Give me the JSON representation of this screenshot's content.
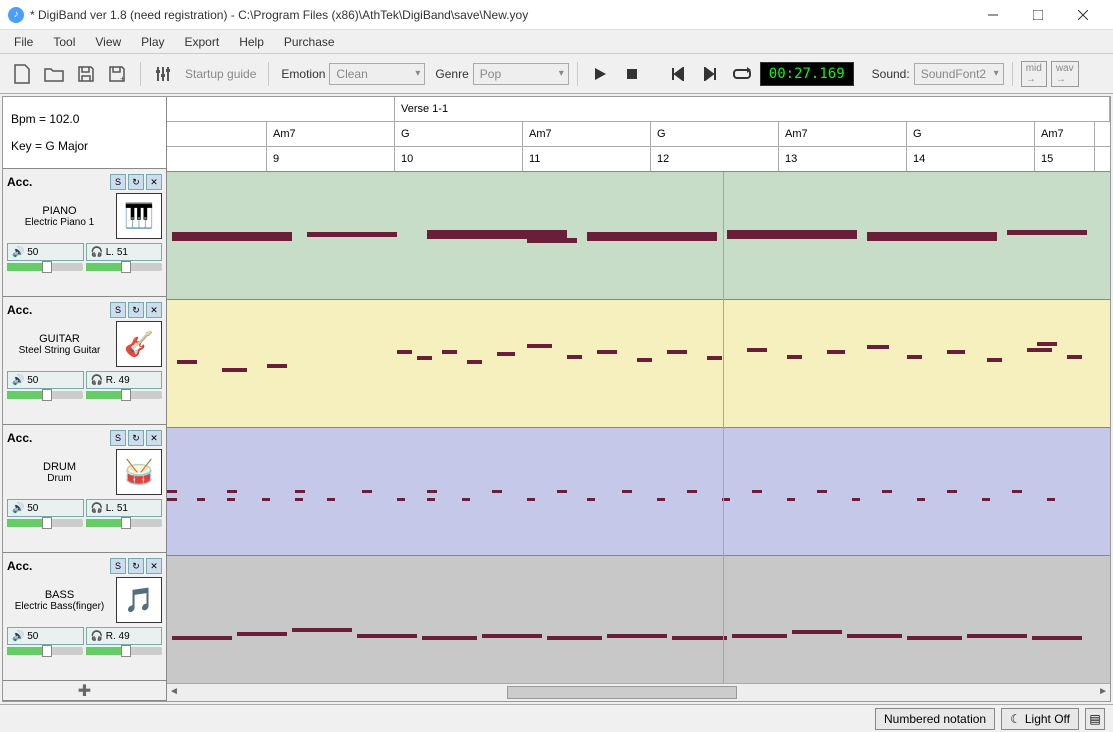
{
  "window": {
    "title": "* DigiBand ver 1.8  (need registration)  -  C:\\Program Files (x86)\\AthTek\\DigiBand\\save\\New.yoy"
  },
  "menu": [
    "File",
    "Tool",
    "View",
    "Play",
    "Export",
    "Help",
    "Purchase"
  ],
  "toolbar": {
    "startup_guide": "Startup guide",
    "emotion_label": "Emotion",
    "emotion_value": "Clean",
    "genre_label": "Genre",
    "genre_value": "Pop",
    "time": "00:27.169",
    "sound_label": "Sound:",
    "sound_value": "SoundFont2",
    "mid_btn": "mid",
    "wav_btn": "wav"
  },
  "info": {
    "bpm_label": "Bpm  =  102.0",
    "key_label": "Key  =   G   Major"
  },
  "grid": {
    "verse": "Verse 1-1",
    "chords": [
      "Am7",
      "G",
      "Am7",
      "G",
      "Am7",
      "G",
      "Am7"
    ],
    "bars": [
      "9",
      "10",
      "11",
      "12",
      "13",
      "14",
      "15"
    ]
  },
  "tracks": [
    {
      "acc": "Acc.",
      "name": "PIANO",
      "inst": "Electric Piano 1",
      "vol": "50",
      "pan": "L. 51",
      "icon": "piano",
      "bg": "lane-piano"
    },
    {
      "acc": "Acc.",
      "name": "GUITAR",
      "inst": "Steel String Guitar",
      "vol": "50",
      "pan": "R. 49",
      "icon": "guitar",
      "bg": "lane-guitar"
    },
    {
      "acc": "Acc.",
      "name": "DRUM",
      "inst": "Drum",
      "vol": "50",
      "pan": "L. 51",
      "icon": "drum",
      "bg": "lane-drum"
    },
    {
      "acc": "Acc.",
      "name": "BASS",
      "inst": "Electric Bass(finger)",
      "vol": "50",
      "pan": "R. 49",
      "icon": "bass",
      "bg": "lane-bass"
    }
  ],
  "status": {
    "notation": "Numbered notation",
    "light": "Light Off"
  }
}
